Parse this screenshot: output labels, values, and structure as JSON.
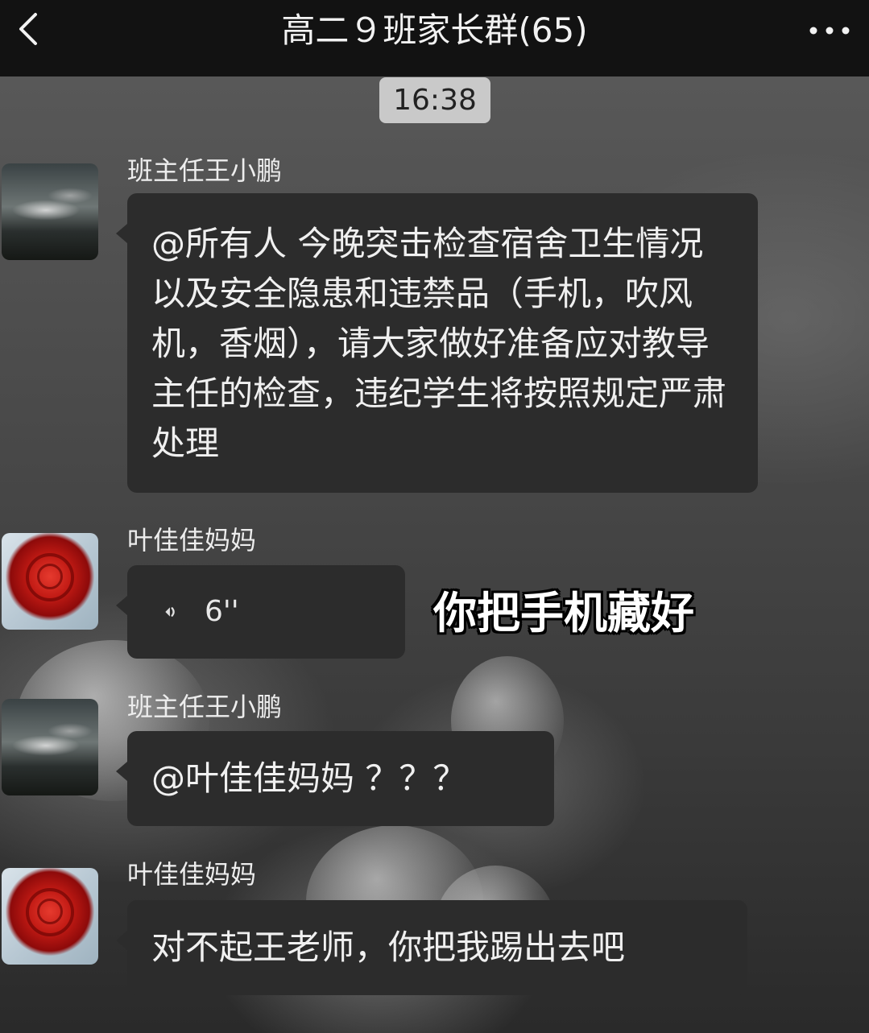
{
  "header": {
    "back_icon": "chevron-left-icon",
    "title": "高二９班家长群(65)",
    "more_icon": "more-dots-icon"
  },
  "chat": {
    "timestamp": "16:38",
    "messages": [
      {
        "sender": "班主任王小鹏",
        "avatar": "sky-landscape-avatar",
        "type": "text",
        "text": "@所有人 今晚突击检查宿舍卫生情况以及安全隐患和违禁品（手机，吹风机，香烟），请大家做好准备应对教导主任的检查，违纪学生将按照规定严肃处理"
      },
      {
        "sender": "叶佳佳妈妈",
        "avatar": "red-rose-avatar",
        "type": "voice",
        "voice_icon": "voice-wave-icon",
        "duration": "6''"
      },
      {
        "sender": "班主任王小鹏",
        "avatar": "sky-landscape-avatar",
        "type": "text",
        "text": "@叶佳佳妈妈 ？？？"
      },
      {
        "sender": "叶佳佳妈妈",
        "avatar": "red-rose-avatar",
        "type": "text",
        "text": "对不起王老师，你把我踢出去吧"
      }
    ]
  },
  "overlay": {
    "caption": "你把手机藏好"
  },
  "colors": {
    "topbar": "#121212",
    "bubble": "#2c2c2c",
    "timestamp_badge": "#c9c9c9"
  }
}
